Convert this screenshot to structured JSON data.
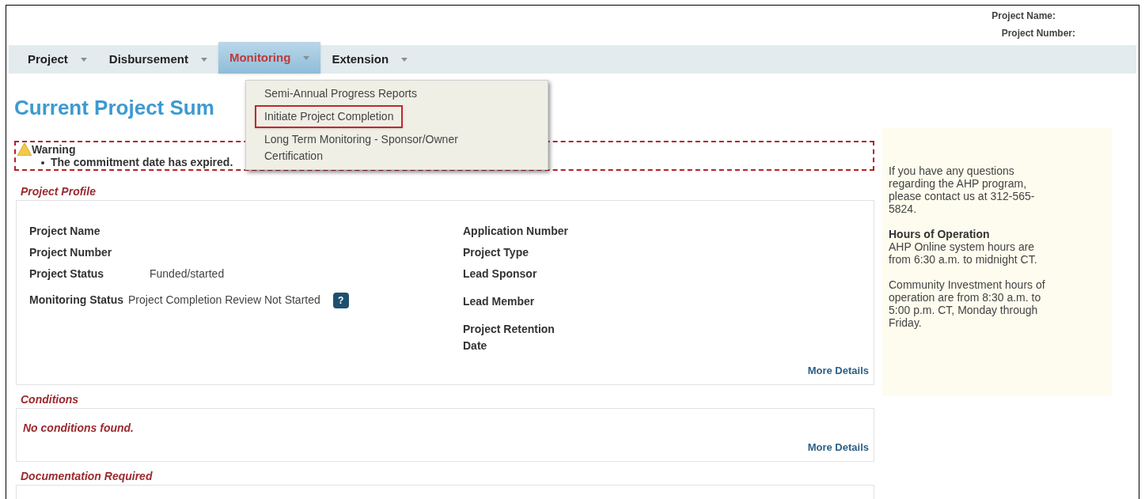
{
  "header": {
    "project_name_label": "Project Name:",
    "project_number_label": "Project Number:"
  },
  "nav": [
    {
      "label": "Project",
      "selected": false
    },
    {
      "label": "Disbursement",
      "selected": false
    },
    {
      "label": "Monitoring",
      "selected": true
    },
    {
      "label": "Extension",
      "selected": false
    }
  ],
  "dropdown": [
    {
      "label": "Semi-Annual Progress Reports",
      "selected": false
    },
    {
      "label": "Initiate Project Completion",
      "selected": true
    },
    {
      "label": "Long Term Monitoring - Sponsor/Owner Certification",
      "selected": false
    }
  ],
  "title": "Current Project Sum",
  "warning": {
    "title": "Warning",
    "messages": [
      "The commitment date has expired."
    ]
  },
  "profile": {
    "legend": "Project Profile",
    "left_fields": [
      {
        "label": "Project Name"
      },
      {
        "label": "Project Number"
      },
      {
        "label": "Project Status",
        "value": "Funded/started"
      },
      {
        "label": "Monitoring Status",
        "value": "Project Completion Review Not Started",
        "help": "?"
      }
    ],
    "right_fields": [
      {
        "label": "Application Number"
      },
      {
        "label": "Project Type"
      },
      {
        "label": "Lead Sponsor"
      },
      {
        "label": "Lead Member"
      },
      {
        "label": "Project Retention Date"
      }
    ],
    "more_details": "More Details"
  },
  "conditions": {
    "legend": "Conditions",
    "message": "No conditions found.",
    "more_details": "More Details"
  },
  "documentation": {
    "legend": "Documentation Required"
  },
  "info_panel": {
    "intro": "If you have any questions regarding the AHP program, please contact us at 312-565-5824.",
    "hours_title": "Hours of Operation",
    "hours_text": "AHP Online system hours are from 6:30 a.m. to midnight CT.",
    "community_text": "Community Investment hours of operation are from 8:30 a.m. to 5:00 p.m. CT, Monday through Friday."
  }
}
